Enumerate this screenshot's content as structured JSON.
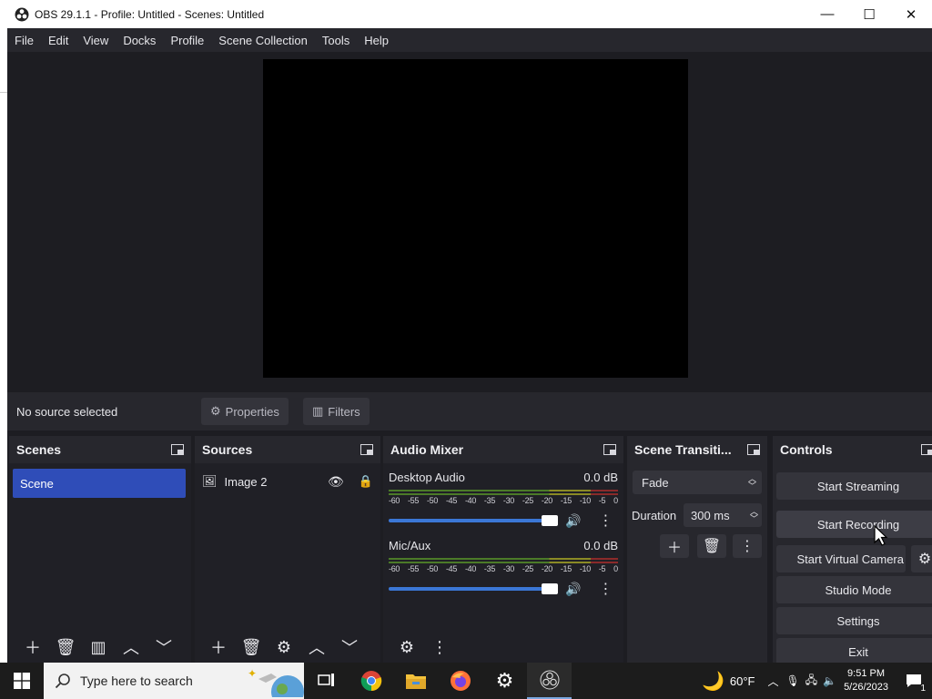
{
  "window": {
    "title": "OBS 29.1.1 - Profile: Untitled - Scenes: Untitled",
    "minimize": "—",
    "maximize": "☐",
    "close": "✕"
  },
  "menu": [
    "File",
    "Edit",
    "View",
    "Docks",
    "Profile",
    "Scene Collection",
    "Tools",
    "Help"
  ],
  "source_bar": {
    "status": "No source selected",
    "properties": "Properties",
    "filters": "Filters"
  },
  "scenes": {
    "title": "Scenes",
    "items": [
      "Scene"
    ]
  },
  "sources": {
    "title": "Sources",
    "items": [
      "Image 2"
    ]
  },
  "audio_mixer": {
    "title": "Audio Mixer",
    "scale": [
      "-60",
      "-55",
      "-50",
      "-45",
      "-40",
      "-35",
      "-30",
      "-25",
      "-20",
      "-15",
      "-10",
      "-5",
      "0"
    ],
    "channels": [
      {
        "name": "Desktop Audio",
        "level": "0.0 dB",
        "volume": 1.0
      },
      {
        "name": "Mic/Aux",
        "level": "0.0 dB",
        "volume": 1.0
      }
    ]
  },
  "transitions": {
    "title": "Scene Transiti...",
    "selected": "Fade",
    "duration_label": "Duration",
    "duration_value": "300 ms"
  },
  "controls": {
    "title": "Controls",
    "start_streaming": "Start Streaming",
    "start_recording": "Start Recording",
    "start_virtual_camera": "Start Virtual Camera",
    "studio_mode": "Studio Mode",
    "settings": "Settings",
    "exit": "Exit"
  },
  "taskbar": {
    "search_placeholder": "Type here to search",
    "weather": "60°F",
    "time": "9:51 PM",
    "date": "5/26/2023",
    "notifications": "1"
  },
  "colors": {
    "accent": "#2f4db8",
    "panel": "#27272d",
    "button": "#34343b"
  }
}
